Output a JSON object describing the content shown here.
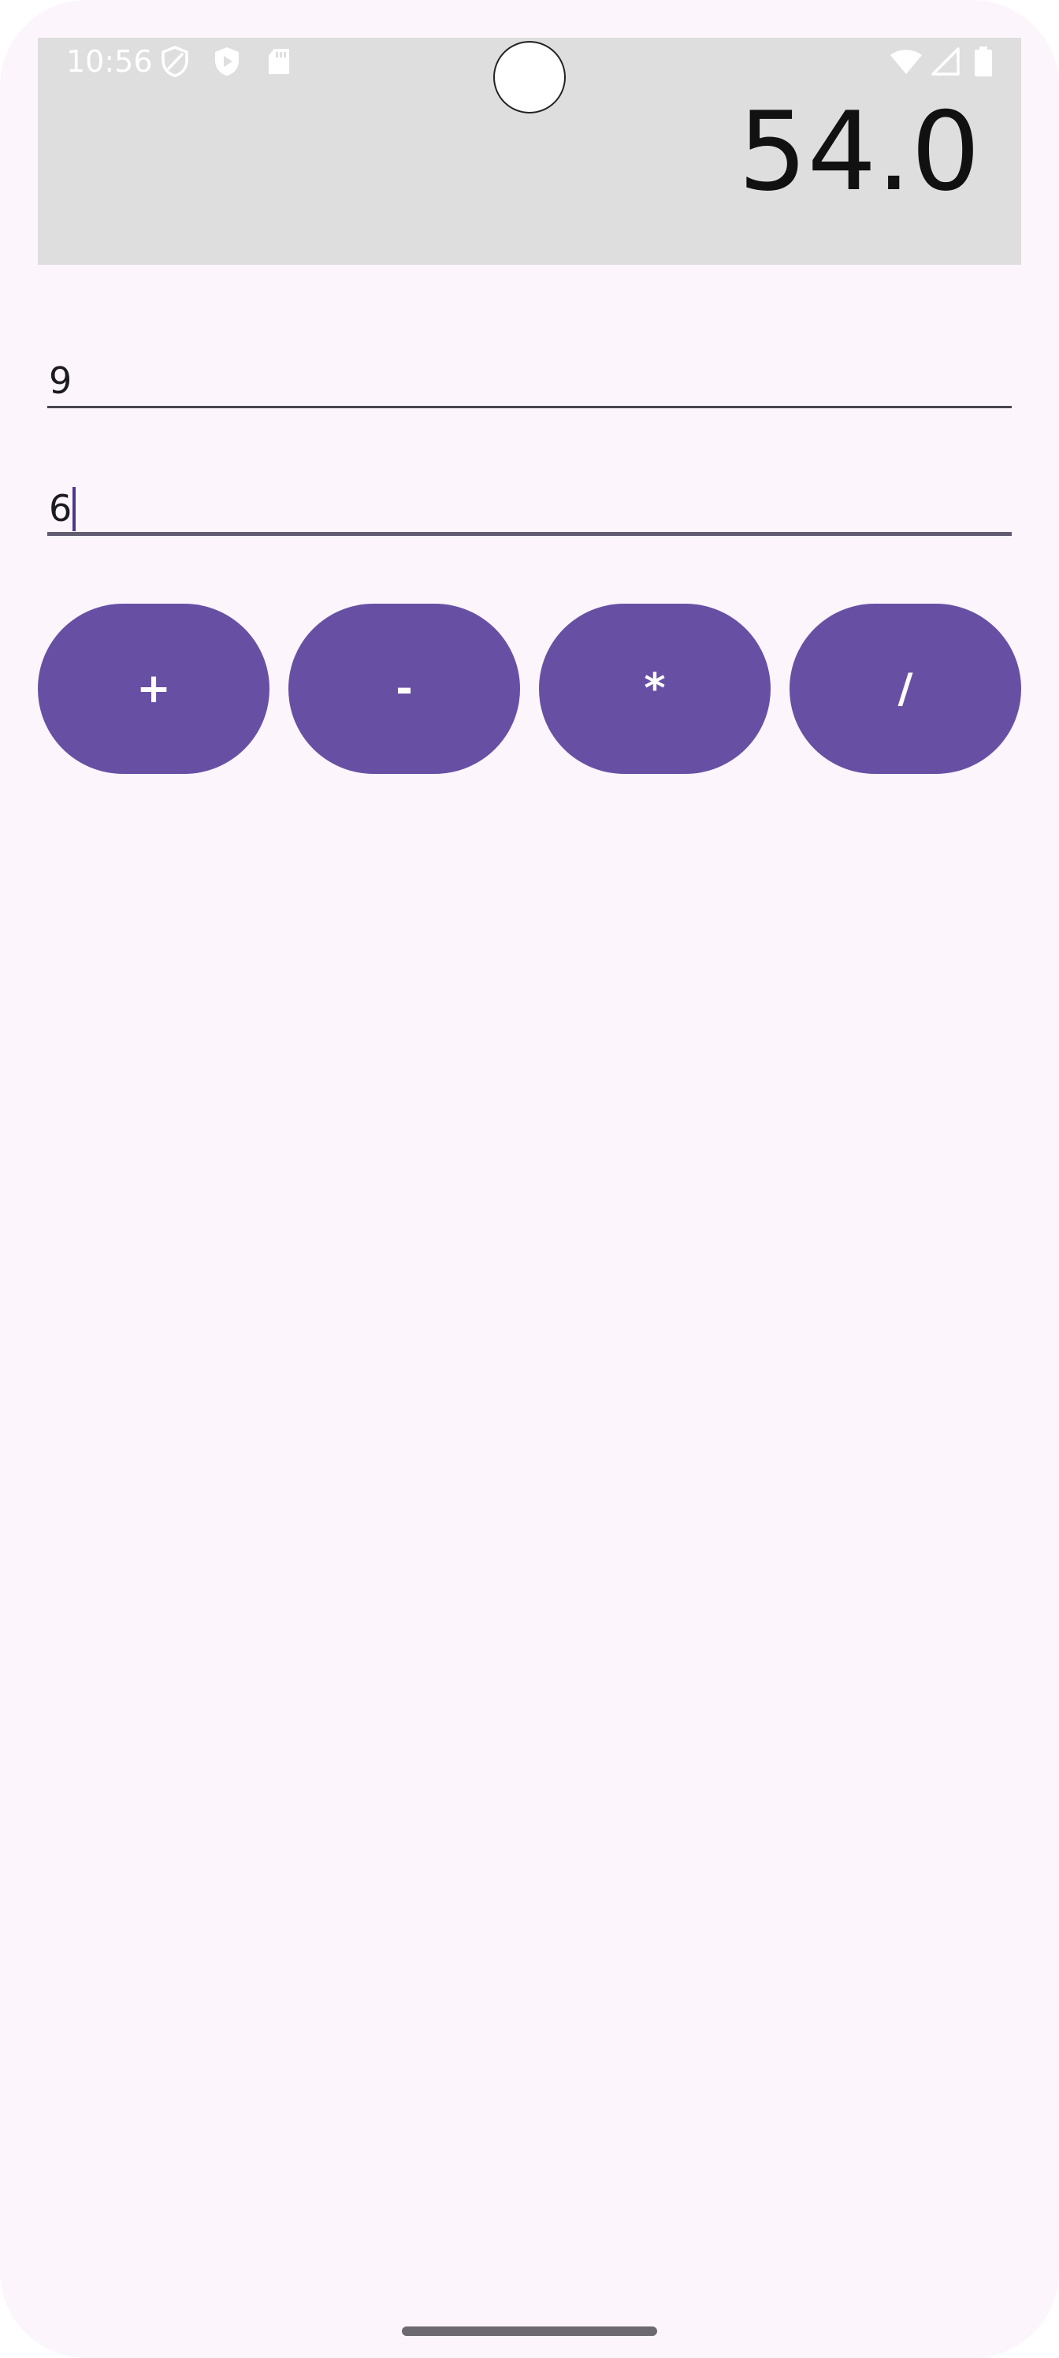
{
  "status_bar": {
    "time": "10:56",
    "left_icons": [
      "shield-outline-icon",
      "play-protect-icon",
      "sd-card-icon"
    ],
    "right_icons": [
      "wifi-icon",
      "signal-icon",
      "battery-icon"
    ]
  },
  "result": {
    "value": "54.0"
  },
  "inputs": {
    "first_value": "9",
    "second_value": "6"
  },
  "operators": {
    "add_label": "+",
    "subtract_label": "-",
    "multiply_label": "*",
    "divide_label": "/"
  },
  "colors": {
    "background": "#fcf5fc",
    "result_panel": "#dedede",
    "button": "#6750a4",
    "button_text": "#ffffff"
  }
}
